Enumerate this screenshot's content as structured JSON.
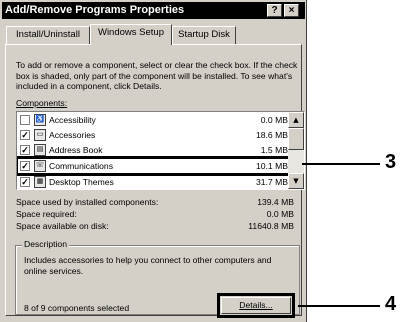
{
  "window": {
    "title": "Add/Remove Programs Properties",
    "help_glyph": "?",
    "close_glyph": "×"
  },
  "tabs": [
    {
      "label": "Install/Uninstall",
      "active": false
    },
    {
      "label": "Windows Setup",
      "active": true
    },
    {
      "label": "Startup Disk",
      "active": false
    }
  ],
  "intro": "To add or remove a component, select or clear the check box. If the check box is shaded, only part of the component will be installed. To see what's included in a component, click Details.",
  "components_label": "Components:",
  "components": [
    {
      "name": "Accessibility",
      "size": "0.0 MB",
      "checked": false,
      "icon": "accessibility-icon",
      "glyph": "♿"
    },
    {
      "name": "Accessories",
      "size": "18.6 MB",
      "checked": true,
      "icon": "accessories-icon",
      "glyph": "▭"
    },
    {
      "name": "Address Book",
      "size": "1.5 MB",
      "checked": true,
      "icon": "address-book-icon",
      "glyph": "▤"
    },
    {
      "name": "Communications",
      "size": "10.1 MB",
      "checked": true,
      "icon": "communications-icon",
      "glyph": "☏"
    },
    {
      "name": "Desktop Themes",
      "size": "31.7 MB",
      "checked": true,
      "icon": "desktop-themes-icon",
      "glyph": "▦"
    }
  ],
  "check_glyph": "✓",
  "stats": [
    {
      "label": "Space used by installed components:",
      "value": "139.4 MB"
    },
    {
      "label": "Space required:",
      "value": "0.0 MB"
    },
    {
      "label": "Space available on disk:",
      "value": "11640.8 MB"
    }
  ],
  "description": {
    "title": "Description",
    "text": "Includes accessories to help you connect to other computers and online services.",
    "selected_count": "8 of 9 components selected",
    "details_button": "Details..."
  },
  "callouts": {
    "communications": "3",
    "details": "4"
  }
}
